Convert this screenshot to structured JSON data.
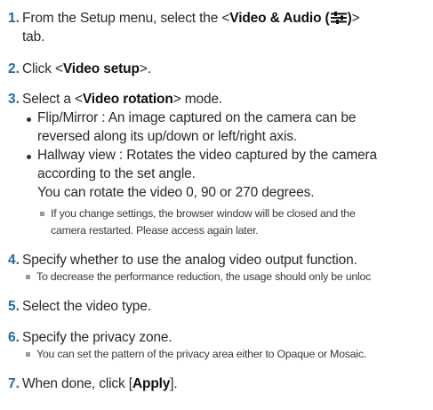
{
  "steps": [
    {
      "num": "1.",
      "prefix": "From the Setup menu, select the <",
      "bold": "Video & Audio (",
      "after_icon": ")",
      "suffix": ">",
      "cont": "tab."
    },
    {
      "num": "2.",
      "prefix": "Click <",
      "bold": "Video setup",
      "suffix": ">."
    },
    {
      "num": "3.",
      "prefix": "Select a <",
      "bold": "Video rotation",
      "suffix": "> mode."
    },
    {
      "num": "4.",
      "text": "Specify whether to use the analog video output function."
    },
    {
      "num": "5.",
      "text": "Select the video type."
    },
    {
      "num": "6.",
      "text": "Specify the privacy zone."
    },
    {
      "num": "7.",
      "prefix": "When done, click [",
      "bold": "Apply",
      "suffix": "]."
    }
  ],
  "rotation_bullets": [
    {
      "lines": [
        "Flip/Mirror : An image captured on the camera can be",
        "reversed along its up/down or left/right axis."
      ]
    },
    {
      "lines": [
        "Hallway view : Rotates the video captured by the camera",
        "according to the set angle.",
        "You can rotate the video 0, 90 or 270 degrees."
      ]
    }
  ],
  "notes": {
    "rotation": [
      "If you change settings, the browser window will be closed and the",
      "camera restarted. Please access again later."
    ],
    "analog": "To decrease the performance reduction, the usage should only be unloc",
    "privacy": "You can set the pattern of the privacy area either to Opaque or Mosaic."
  },
  "icons": {
    "video_audio_tab": "sliders-icon"
  }
}
